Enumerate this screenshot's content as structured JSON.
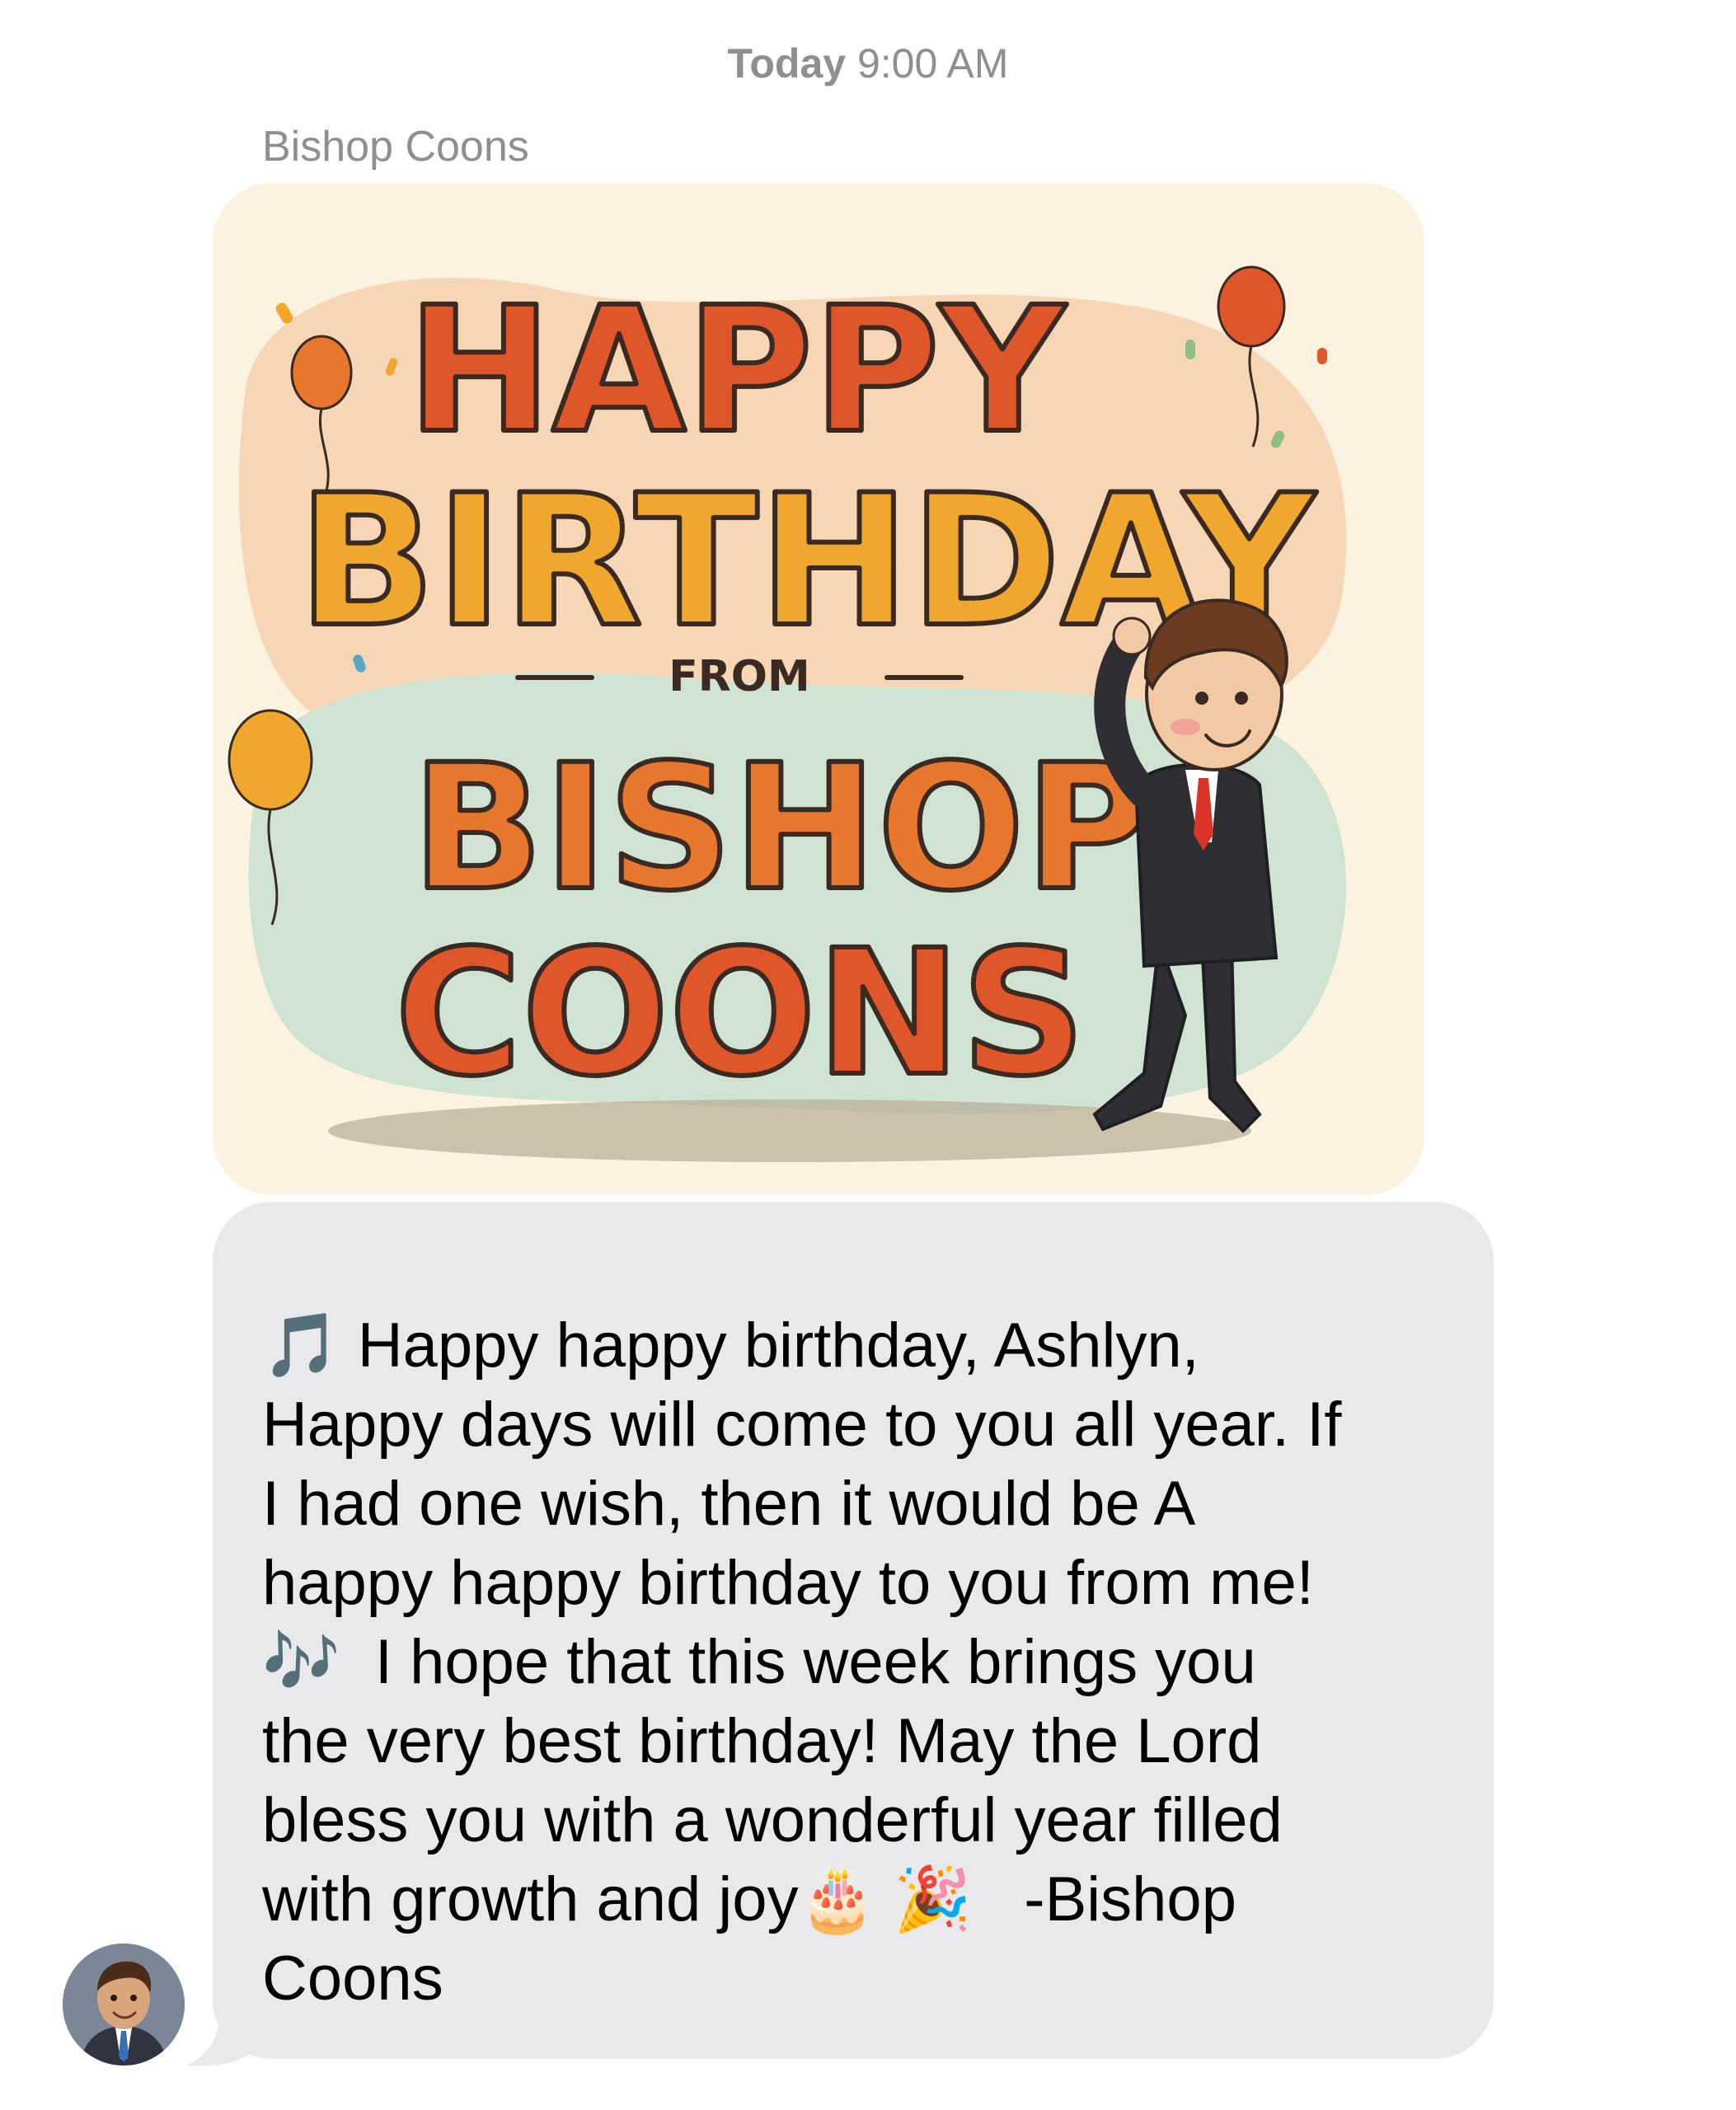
{
  "header": {
    "timestamp_day": "Today",
    "timestamp_time": "9:00 AM"
  },
  "conversation": {
    "sender_name": "Bishop Coons"
  },
  "image_card": {
    "line1": "HAPPY",
    "line2": "BIRTHDAY",
    "line3": "FROM",
    "line4": "BISHOP",
    "line5": "COONS",
    "colors": {
      "red_orange": "#e0562b",
      "golden": "#f0a72d",
      "orange": "#e8772e",
      "outline": "#3a2a22",
      "peach_blob": "#f6d6b4",
      "mint_blob": "#cfe3d2",
      "cream_bg": "#fbf3df"
    }
  },
  "message": {
    "text": "🎵 Happy happy birthday, Ashlyn,\nHappy days will come to you all year. If\nI had one wish, then it would be A\nhappy happy birthday to you from me!\n🎶  I hope that this week brings you\nthe very best birthday! May the Lord\nbless you with a wonderful year filled\nwith growth and joy🎂 🎉   -Bishop\nCoons"
  },
  "colors": {
    "bubble_bg": "#e9e9eb",
    "meta_text": "#8e8e93"
  }
}
